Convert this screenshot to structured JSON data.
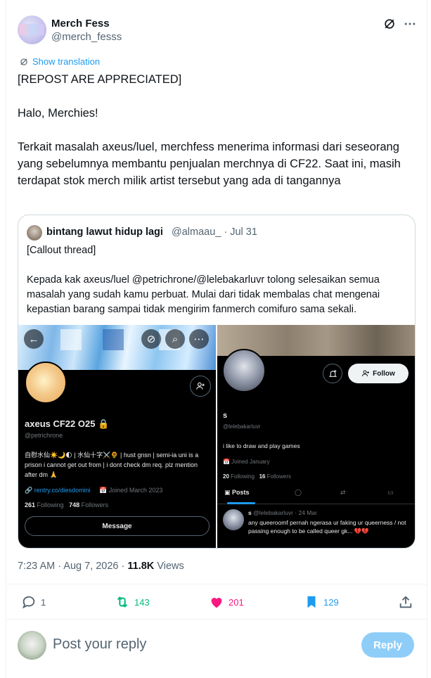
{
  "author": {
    "name": "Merch Fess",
    "handle": "@merch_fesss"
  },
  "translate_label": "Show translation",
  "post_paragraphs": [
    "[REPOST ARE APPRECIATED]",
    "Halo, Merchies!",
    "Terkait masalah axeus/luel, merchfess menerima informasi dari seseorang yang sebelumnya membantu penjualan merchnya di CF22. Saat ini, masih terdapat stok merch milik artist tersebut yang ada di tangannya"
  ],
  "quote": {
    "name": "bintang lawut hidup lagi",
    "handle": "@almaau_",
    "date": "· Jul 31",
    "paragraphs": [
      "[Callout thread]",
      "Kepada kak axeus/luel @petrichrone/@lelebakarluvr tolong selesaikan semua masalah yang sudah kamu perbuat. Mulai dari tidak membalas chat mengenai kepastian barang sampai tidak mengirim fanmerch comifuro sama sekali."
    ],
    "left_screenshot": {
      "title": "axeus CF22 O25 🔒",
      "handle": "@petrichrone",
      "bio": "自慰水仙☀️🌙🌓 | 水仙十字⚔️🌻 | hust gnsn | semi-ia uni is a prison i cannot get out from | i dont check dm req. plz mention after dm 🙏",
      "link": "🔗 rentry.co/diesdomini",
      "joined": "📅 Joined March 2023",
      "following_count": "261",
      "following_label": "Following",
      "followers_count": "748",
      "followers_label": "Followers",
      "message_label": "Message"
    },
    "right_screenshot": {
      "name": "s",
      "handle": "@lelebakarluvr",
      "bio": "i like to draw and play games",
      "joined": "📅 Joined January",
      "following_count": "20",
      "following_label": "Following",
      "followers_count": "16",
      "followers_label": "Followers",
      "follow_label": "Follow",
      "tab_posts": "Posts",
      "post_author": "s",
      "post_handle_date": "@lelebakarluvr · 24 Mar",
      "post_text": "any queeroomf pernah ngerasa ur faking ur queerness / not passing enough to be called queer gk... 💔💔"
    }
  },
  "meta": {
    "time": "7:23 AM · Aug 7, 2026 · ",
    "views_count": "11.8K",
    "views_label": " Views"
  },
  "actions": {
    "replies": "1",
    "reposts": "143",
    "likes": "201",
    "bookmarks": "129"
  },
  "reply_box": {
    "placeholder": "Post your reply",
    "button_label": "Reply"
  },
  "colors": {
    "accent": "#1d9bf0",
    "repost": "#00ba7c",
    "like": "#f91880",
    "reply_button": "#8ecdf8"
  }
}
